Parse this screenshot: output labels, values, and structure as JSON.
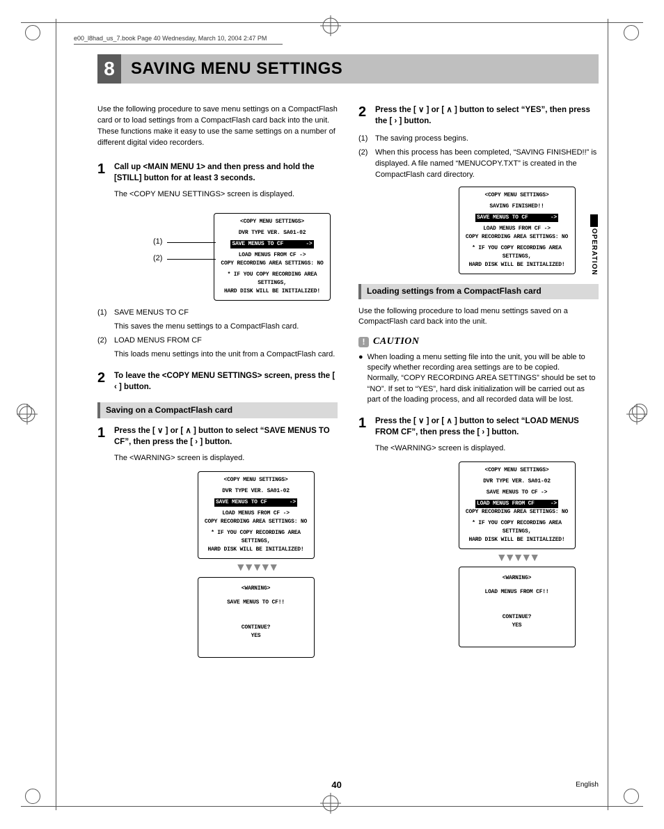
{
  "bookInfo": "e00_l8had_us_7.book  Page 40  Wednesday, March 10, 2004  2:47 PM",
  "chapter": {
    "num": "8",
    "title": "SAVING MENU SETTINGS"
  },
  "sideTab": "OPERATION",
  "footer": {
    "page": "40",
    "lang": "English"
  },
  "left": {
    "intro": "Use the following procedure to save menu settings on a CompactFlash card or to load settings from a CompactFlash card back into the unit. These functions make it easy to use the same settings on a number of different digital video recorders.",
    "step1": {
      "num": "1",
      "title": "Call up <MAIN MENU 1> and then press and hold the [STILL] button for at least 3 seconds.",
      "after": "The <COPY MENU SETTINGS> screen is displayed."
    },
    "callouts": {
      "one": "(1)",
      "two": "(2)"
    },
    "screen1": {
      "l1": "<COPY MENU SETTINGS>",
      "l2": "DVR TYPE VER. SA01-02",
      "l3a": "SAVE MENUS TO CF",
      "l3b": "->",
      "l4": "LOAD MENUS FROM CF      ->",
      "l5": "COPY RECORDING AREA SETTINGS: NO",
      "l6": "* IF YOU COPY RECORDING AREA SETTINGS,",
      "l7": "HARD DISK WILL BE INITIALIZED!"
    },
    "legend": {
      "i1label": "(1)",
      "i1title": "SAVE MENUS TO CF",
      "i1text": "This saves the menu settings to a CompactFlash card.",
      "i2label": "(2)",
      "i2title": "LOAD MENUS FROM CF",
      "i2text": "This loads menu settings into the unit from a CompactFlash card."
    },
    "step2": {
      "num": "2",
      "title": "To leave the <COPY MENU SETTINGS> screen, press the [ ‹ ] button."
    },
    "section1": "Saving on a CompactFlash card",
    "saveStep1": {
      "num": "1",
      "title": "Press the [ ∨ ] or [ ∧ ] button to select “SAVE MENUS TO CF”, then press the [ › ] button.",
      "after": "The <WARNING> screen is displayed."
    },
    "screen2warn": {
      "l1": "<WARNING>",
      "l2": "SAVE MENUS TO CF!!",
      "l3": "CONTINUE?",
      "l4": "YES"
    }
  },
  "right": {
    "step2": {
      "num": "2",
      "title": "Press the [ ∨ ] or [ ∧ ] button to select “YES”, then press the [ › ] button.",
      "sub1label": "(1)",
      "sub1": "The saving process begins.",
      "sub2label": "(2)",
      "sub2": "When this process has been completed, “SAVING FINISHED!!” is displayed. A file named “MENUCOPY.TXT” is created in the CompactFlash card directory."
    },
    "screenFin": {
      "l1": "<COPY MENU SETTINGS>",
      "l2": "SAVING FINISHED!!",
      "l3a": "SAVE MENUS TO CF",
      "l3b": "->",
      "l4": "LOAD MENUS FROM CF      ->",
      "l5": "COPY RECORDING AREA SETTINGS: NO",
      "l6": "* IF YOU COPY RECORDING AREA SETTINGS,",
      "l7": "HARD DISK WILL BE INITIALIZED!"
    },
    "section2": "Loading settings from a CompactFlash card",
    "loadIntro": "Use the following procedure to load menu settings saved on a CompactFlash card back into the unit.",
    "cautionLabel": "CAUTION",
    "cautionText": "When loading a menu setting file into the unit, you will be able to specify whether recording area settings are to be copied.\nNormally, “COPY RECORDING AREA SETTINGS” should be set to “NO”. If set to “YES”, hard disk initialization will be carried out as part of the loading process, and all recorded data will be lost.",
    "loadStep1": {
      "num": "1",
      "title": "Press the [ ∨ ] or [ ∧ ] button to select “LOAD MENUS FROM CF”, then press the [ › ] button.",
      "after": "The <WARNING> screen is displayed."
    },
    "screenLoad": {
      "l1": "<COPY MENU SETTINGS>",
      "l2": "DVR TYPE VER. SA01-02",
      "l3": "SAVE MENUS TO CF        ->",
      "l4a": "LOAD MENUS FROM CF",
      "l4b": "->",
      "l5": "COPY RECORDING AREA SETTINGS: NO",
      "l6": "* IF YOU COPY RECORDING AREA SETTINGS,",
      "l7": "HARD DISK WILL BE INITIALIZED!"
    },
    "screenLoadWarn": {
      "l1": "<WARNING>",
      "l2": "LOAD MENUS FROM CF!!",
      "l3": "CONTINUE?",
      "l4": "YES"
    }
  }
}
